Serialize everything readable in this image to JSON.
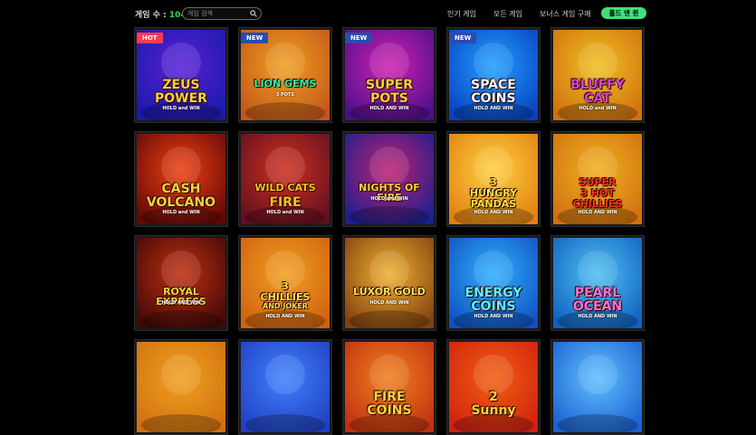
{
  "header": {
    "count_label": "게임 수 :",
    "count_value": "104",
    "search_placeholder": "게임 검색",
    "nav": [
      {
        "label": "인기 게임"
      },
      {
        "label": "모든 게임"
      },
      {
        "label": "보너스 게임 구매"
      }
    ],
    "active_pill": "홀드 앤 윈"
  },
  "games": [
    {
      "badge": "HOT",
      "lines": [
        "ZEUS",
        "POWER"
      ],
      "sub": "HOLD and WIN",
      "bg1": "#1a1aa8",
      "bg2": "#5a20d8",
      "fg": "#ffd23a"
    },
    {
      "badge": "NEW",
      "lines": [
        "LION GEMS"
      ],
      "sub": "3 POTS",
      "bg1": "#c2561a",
      "bg2": "#f0a020",
      "fg": "#2cf0a0"
    },
    {
      "badge": "NEW",
      "lines": [
        "SUPER",
        "POTS"
      ],
      "sub": "HOLD AND WIN",
      "bg1": "#4a108a",
      "bg2": "#d020b0",
      "fg": "#ffd23a"
    },
    {
      "badge": "NEW",
      "lines": [
        "SPACE",
        "COINS"
      ],
      "sub": "HOLD AND WIN",
      "bg1": "#0a40c0",
      "bg2": "#20a0ff",
      "fg": "#ffffff"
    },
    {
      "badge": "",
      "lines": [
        "BLUFFY",
        "CAT"
      ],
      "sub": "HOLD and WIN",
      "bg1": "#d07010",
      "bg2": "#f0c020",
      "fg": "#e040d0"
    },
    {
      "badge": "",
      "lines": [
        "CASH",
        "VOLCANO"
      ],
      "sub": "HOLD and WIN",
      "bg1": "#600808",
      "bg2": "#f04010",
      "fg": "#ffd23a"
    },
    {
      "badge": "",
      "lines": [
        "WILD CATS",
        "FIRE"
      ],
      "sub": "HOLD and WIN",
      "bg1": "#601020",
      "bg2": "#d03020",
      "fg": "#ffc020"
    },
    {
      "badge": "",
      "lines": [
        "NIGHTS OF FIRE"
      ],
      "sub": "HOLD and WIN",
      "bg1": "#1a2090",
      "bg2": "#c02070",
      "fg": "#ffd23a"
    },
    {
      "badge": "",
      "lines": [
        "3",
        "HUNGRY",
        "PANDAS"
      ],
      "sub": "HOLD AND WIN",
      "bg1": "#e08010",
      "bg2": "#ffd040",
      "fg": "#ffe040"
    },
    {
      "badge": "",
      "lines": [
        "SUPER",
        "3 HOT",
        "CHILLIES"
      ],
      "sub": "HOLD AND WIN",
      "bg1": "#d07010",
      "bg2": "#f0b020",
      "fg": "#ff3020"
    },
    {
      "badge": "",
      "lines": [
        "ROYAL EXPRESS"
      ],
      "sub": "HOLD AND WIN",
      "bg1": "#400808",
      "bg2": "#c03010",
      "fg": "#ffd23a"
    },
    {
      "badge": "",
      "lines": [
        "3",
        "CHILLIES",
        "AND JOKER"
      ],
      "sub": "HOLD AND WIN",
      "bg1": "#d06010",
      "bg2": "#f0a020",
      "fg": "#ffe040"
    },
    {
      "badge": "",
      "lines": [
        "LUXOR GOLD"
      ],
      "sub": "HOLD AND WIN",
      "bg1": "#804010",
      "bg2": "#f0b030",
      "fg": "#ffe060"
    },
    {
      "badge": "",
      "lines": [
        "ENERGY",
        "COINS"
      ],
      "sub": "HOLD AND WIN",
      "bg1": "#1050c0",
      "bg2": "#30b0ff",
      "fg": "#60f0ff"
    },
    {
      "badge": "",
      "lines": [
        "PEARL",
        "OCEAN"
      ],
      "sub": "HOLD AND WIN",
      "bg1": "#1060c0",
      "bg2": "#50c0f0",
      "fg": "#ff70d0"
    },
    {
      "badge": "",
      "lines": [],
      "sub": "",
      "bg1": "#d07010",
      "bg2": "#f0a020",
      "fg": "#ffd23a"
    },
    {
      "badge": "",
      "lines": [],
      "sub": "",
      "bg1": "#2040c0",
      "bg2": "#4080ff",
      "fg": "#ffd23a"
    },
    {
      "badge": "",
      "lines": [
        "FIRE",
        "COINS"
      ],
      "sub": "",
      "bg1": "#c03010",
      "bg2": "#f08020",
      "fg": "#ffd23a"
    },
    {
      "badge": "",
      "lines": [
        "2",
        "Sunny"
      ],
      "sub": "",
      "bg1": "#d02010",
      "bg2": "#f06010",
      "fg": "#ffd23a"
    },
    {
      "badge": "",
      "lines": [],
      "sub": "",
      "bg1": "#1a60d0",
      "bg2": "#60c0ff",
      "fg": "#ffd23a"
    }
  ]
}
